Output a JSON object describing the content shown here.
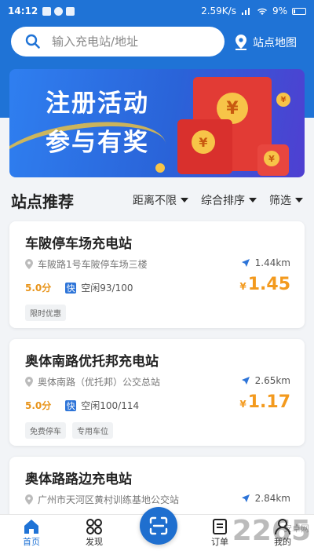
{
  "status_bar": {
    "time": "14:12",
    "network_speed": "2.59K/s",
    "battery": "9%"
  },
  "search": {
    "placeholder": "输入充电站/地址"
  },
  "map_button": {
    "label": "站点地图"
  },
  "banner": {
    "line1": "注册活动",
    "line2": "参与有奖",
    "symbol": "¥"
  },
  "section": {
    "title": "站点推荐",
    "filters": [
      "距离不限",
      "综合排序",
      "筛选"
    ]
  },
  "stations": [
    {
      "name": "车陂停车场充电站",
      "address": "车陂路1号车陂停车场三楼",
      "distance": "1.44km",
      "score": "5.0分",
      "fast_label": "快",
      "availability": "空闲93/100",
      "currency": "¥",
      "price": "1.45",
      "tags": [
        "限时优惠"
      ]
    },
    {
      "name": "奥体南路优托邦充电站",
      "address": "奥体南路（优托邦）公交总站",
      "distance": "2.65km",
      "score": "5.0分",
      "fast_label": "快",
      "availability": "空闲100/114",
      "currency": "¥",
      "price": "1.17",
      "tags": [
        "免费停车",
        "专用车位"
      ]
    },
    {
      "name": "奥体路路边充电站",
      "address": "广州市天河区黄村训练基地公交站",
      "distance": "2.84km"
    }
  ],
  "tabbar": {
    "home": "首页",
    "discover": "发现",
    "orders": "订单",
    "mine": "我的"
  },
  "watermark": {
    "text": "2265",
    "sub": "安卓网"
  },
  "colors": {
    "primary": "#1f73d6",
    "price": "#f39a1e",
    "background": "#f2f4f7"
  }
}
